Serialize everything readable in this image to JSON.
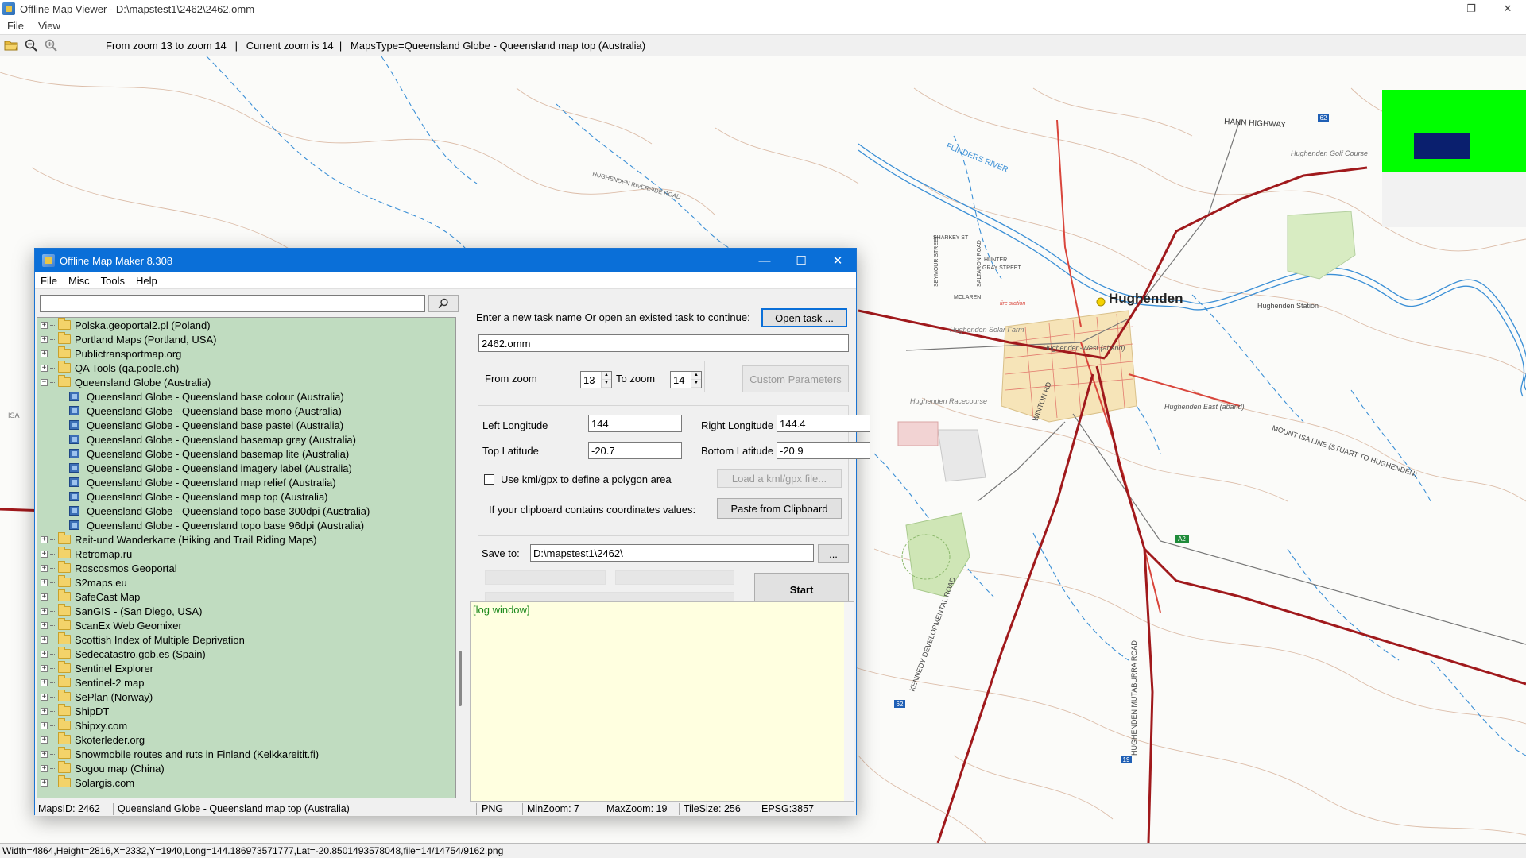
{
  "viewer": {
    "title": "Offline Map Viewer - D:\\mapstest1\\2462\\2462.omm",
    "window_buttons": {
      "minimize": "—",
      "restore": "❐",
      "close": "✕"
    },
    "menu": [
      "File",
      "View"
    ],
    "toolbar": {
      "info": "From zoom 13 to zoom 14   |   Current zoom is 14  |   MapsType=Queensland Globe - Queensland map top (Australia)"
    },
    "status": "Width=4864,Height=2816,X=2332,Y=1940,Long=144.186973571777,Lat=-20.8501493578048,file=14/14754/9162.png"
  },
  "map": {
    "labels": {
      "town": "Hughenden",
      "hann_highway": "HANN  HIGHWAY",
      "flinders_river": "FLINDERS      RIVER",
      "riverside_road": "HUGHENDEN RIVERSIDE ROAD",
      "golf_course": "Hughenden Golf Course",
      "station": "Hughenden Station",
      "solar_farm": "Hughenden Solar Farm",
      "racecourse": "Hughenden Racecourse",
      "east_aband": "Hughenden East (aband)",
      "west_aband": "Hughenden-West (aband)",
      "mount_isa_line": "MOUNT    ISA    LINE   (STUART   TO   HUGHENDEN)",
      "developmental_road": "KENNEDY    DEVELOPMENTAL    ROAD",
      "mutaburra_road": "HUGHENDEN    MUTABURRA    ROAD",
      "winton_rd": "WINTON  RD",
      "flinders_hwy_shield": "A2",
      "route_62_shield": "62",
      "route_19_shield": "19",
      "isa_label": "ISA",
      "sharkey_st": "SHARKEY ST",
      "hunter_st": "HUNTER",
      "gray_st": "GRAY STREET",
      "mclaren_st": "MCLAREN",
      "seymour_st": "SEYMOUR STREET",
      "saltaron_rd": "SALTARON ROAD",
      "fire_station": "fire station"
    },
    "colors": {
      "highway": "#a0191c",
      "road": "#d9453b",
      "water": "#3a8fd6",
      "contour": "#c98b6b",
      "land_feature": "#cfe6b6",
      "overview_bg": "#00ff00",
      "overview_box": "#0a1f6e"
    }
  },
  "maker": {
    "title": "Offline Map Maker 8.308",
    "window_buttons": {
      "minimize": "—",
      "maximize": "☐",
      "close": "✕"
    },
    "menu": [
      "File",
      "Misc",
      "Tools",
      "Help"
    ],
    "search": {
      "value": ""
    },
    "tree": {
      "before": [
        "Polska.geoportal2.pl (Poland)",
        "Portland Maps (Portland, USA)",
        "Publictransportmap.org",
        "QA Tools (qa.poole.ch)"
      ],
      "expanded": "Queensland Globe (Australia)",
      "children": [
        "Queensland Globe - Queensland base colour (Australia)",
        "Queensland Globe - Queensland base mono (Australia)",
        "Queensland Globe - Queensland base pastel (Australia)",
        "Queensland Globe - Queensland basemap grey (Australia)",
        "Queensland Globe - Queensland basemap lite (Australia)",
        "Queensland Globe - Queensland imagery label (Australia)",
        "Queensland Globe - Queensland map relief (Australia)",
        "Queensland Globe - Queensland map top (Australia)",
        "Queensland Globe - Queensland topo base 300dpi (Australia)",
        "Queensland Globe - Queensland topo base 96dpi (Australia)"
      ],
      "after": [
        "Reit-und Wanderkarte (Hiking and Trail Riding Maps)",
        "Retromap.ru",
        "Roscosmos Geoportal",
        "S2maps.eu",
        "SafeCast Map",
        "SanGIS - (San Diego, USA)",
        "ScanEx Web Geomixer",
        "Scottish Index of Multiple Deprivation",
        "Sedecatastro.gob.es (Spain)",
        "Sentinel Explorer",
        "Sentinel-2 map",
        "SePlan (Norway)",
        "ShipDT",
        "Shipxy.com",
        "Skoterleder.org",
        "Snowmobile routes and ruts in Finland (Kelkkareitit.fi)",
        "Sogou map (China)",
        "Solargis.com"
      ]
    },
    "form": {
      "task_label": "Enter a new task name Or open an existed task to continue:",
      "open_task_button": "Open task ...",
      "task_name": "2462.omm",
      "from_zoom_label": "From zoom",
      "from_zoom": "13",
      "to_zoom_label": "To zoom",
      "to_zoom": "14",
      "custom_params_button": "Custom Parameters",
      "left_lon_label": "Left Longitude",
      "left_lon": "144",
      "right_lon_label": "Right Longitude",
      "right_lon": "144.4",
      "top_lat_label": "Top Latitude",
      "top_lat": "-20.7",
      "bottom_lat_label": "Bottom Latitude",
      "bottom_lat": "-20.9",
      "kml_label": "Use kml/gpx to define a polygon area",
      "kml_button": "Load a kml/gpx file...",
      "clipboard_label": "If your clipboard contains coordinates values:",
      "clipboard_button": "Paste from Clipboard",
      "save_to_label": "Save to:",
      "save_to": "D:\\mapstest1\\2462\\",
      "browse_button": "...",
      "start_button": "Start"
    },
    "log": "[log window]",
    "status": {
      "maps_id": "MapsID: 2462",
      "map_name": "Queensland Globe - Queensland map top (Australia)",
      "format": "PNG",
      "min_zoom": "MinZoom: 7",
      "max_zoom": "MaxZoom: 19",
      "tile_size": "TileSize: 256",
      "epsg": "EPSG:3857"
    }
  }
}
